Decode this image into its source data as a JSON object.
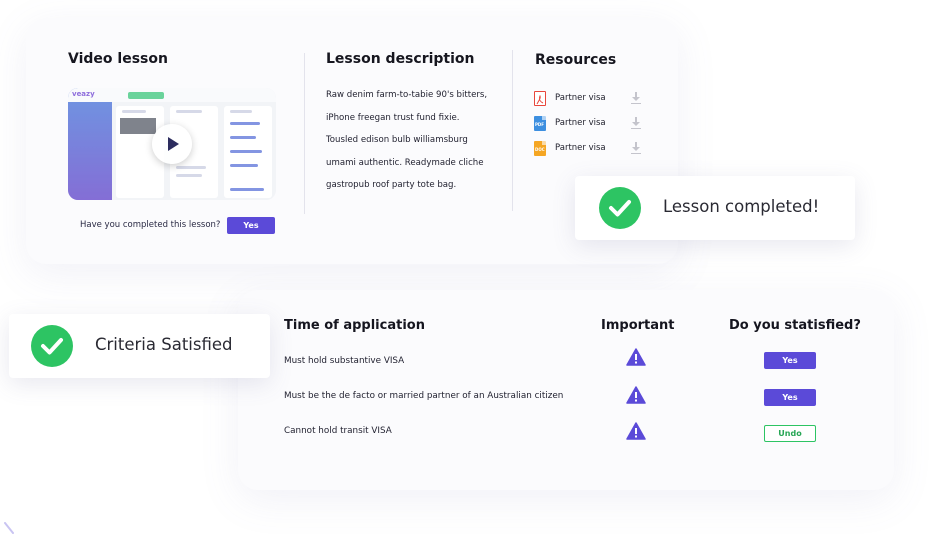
{
  "lesson": {
    "video_title": "Video lesson",
    "video_app_logo": "veazy",
    "question": "Have you completed this lesson?",
    "yes_label": "Yes",
    "description_title": "Lesson description",
    "description_lines": [
      "Raw denim farm-to-tabie 90's bitters,",
      "iPhone freegan trust fund fixie.",
      "Tousled edison bulb williamsburg",
      "umami authentic. Readymade cliche",
      "gastropub roof party tote bag."
    ],
    "resources_title": "Resources",
    "resources": [
      {
        "label": "Partner visa",
        "icon": "pdf-file-icon",
        "color": "#e8463c",
        "tag": "PDF"
      },
      {
        "label": "Partner visa",
        "icon": "doc-file-icon",
        "color": "#3d8fe0",
        "tag": "PDF"
      },
      {
        "label": "Partner visa",
        "icon": "orange-file-icon",
        "color": "#f5a623",
        "tag": "DOC"
      }
    ]
  },
  "toasts": {
    "lesson_completed": "Lesson completed!",
    "criteria_satisfied": "Criteria Satisfied"
  },
  "criteria": {
    "headers": [
      "Time of application",
      "Important",
      "Do you statisfied?"
    ],
    "rows": [
      {
        "text": "Must hold substantive VISA",
        "action": "Yes"
      },
      {
        "text": "Must be the de facto or married partner of an Australian citizen",
        "action": "Yes"
      },
      {
        "text": "Cannot hold transit VISA",
        "action": "Undo"
      }
    ]
  },
  "colors": {
    "accent": "#5b4ad8",
    "success": "#2dc463",
    "warning_icon": "#5b4ad8"
  }
}
